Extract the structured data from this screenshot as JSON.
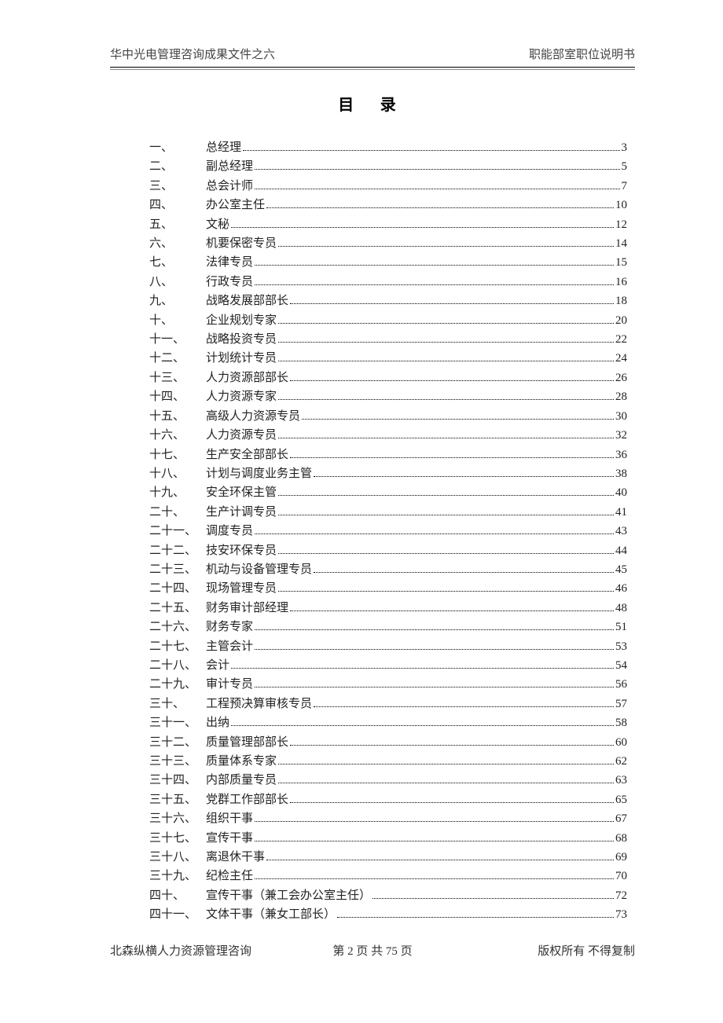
{
  "header": {
    "left": "华中光电管理咨询成果文件之六",
    "right": "职能部室职位说明书"
  },
  "title": "目 录",
  "toc": [
    {
      "num": "一、",
      "title": "总经理",
      "page": "3"
    },
    {
      "num": "二、",
      "title": "副总经理",
      "page": "5"
    },
    {
      "num": "三、",
      "title": "总会计师",
      "page": "7"
    },
    {
      "num": "四、",
      "title": "办公室主任",
      "page": "10"
    },
    {
      "num": "五、",
      "title": "文秘",
      "page": "12"
    },
    {
      "num": "六、",
      "title": "机要保密专员",
      "page": "14"
    },
    {
      "num": "七、",
      "title": "法律专员",
      "page": "15"
    },
    {
      "num": "八、",
      "title": "行政专员",
      "page": "16"
    },
    {
      "num": "九、",
      "title": "战略发展部部长",
      "page": "18"
    },
    {
      "num": "十、",
      "title": "企业规划专家",
      "page": "20"
    },
    {
      "num": "十一、",
      "title": "战略投资专员",
      "page": "22"
    },
    {
      "num": "十二、",
      "title": "计划统计专员",
      "page": "24"
    },
    {
      "num": "十三、",
      "title": "人力资源部部长",
      "page": "26"
    },
    {
      "num": "十四、",
      "title": "人力资源专家",
      "page": "28"
    },
    {
      "num": "十五、",
      "title": "高级人力资源专员",
      "page": "30"
    },
    {
      "num": "十六、",
      "title": "人力资源专员",
      "page": "32"
    },
    {
      "num": "十七、",
      "title": "生产安全部部长",
      "page": "36"
    },
    {
      "num": "十八、",
      "title": "计划与调度业务主管",
      "page": "38"
    },
    {
      "num": "十九、",
      "title": "安全环保主管",
      "page": "40"
    },
    {
      "num": "二十、",
      "title": "生产计调专员",
      "page": "41"
    },
    {
      "num": "二十一、",
      "title": "调度专员",
      "page": "43"
    },
    {
      "num": "二十二、",
      "title": "技安环保专员",
      "page": "44"
    },
    {
      "num": "二十三、",
      "title": "机动与设备管理专员",
      "page": "45"
    },
    {
      "num": "二十四、",
      "title": "现场管理专员",
      "page": "46"
    },
    {
      "num": "二十五、",
      "title": "财务审计部经理",
      "page": "48"
    },
    {
      "num": "二十六、",
      "title": "财务专家",
      "page": "51"
    },
    {
      "num": "二十七、",
      "title": "主管会计",
      "page": "53"
    },
    {
      "num": "二十八、",
      "title": "会计",
      "page": "54"
    },
    {
      "num": "二十九、",
      "title": "审计专员",
      "page": "56"
    },
    {
      "num": "三十、",
      "title": "工程预决算审核专员",
      "page": "57"
    },
    {
      "num": "三十一、",
      "title": "出纳",
      "page": "58"
    },
    {
      "num": "三十二、",
      "title": "质量管理部部长",
      "page": "60"
    },
    {
      "num": "三十三、",
      "title": "质量体系专家",
      "page": "62"
    },
    {
      "num": "三十四、",
      "title": "内部质量专员",
      "page": "63"
    },
    {
      "num": "三十五、",
      "title": "党群工作部部长",
      "page": "65"
    },
    {
      "num": "三十六、",
      "title": "组织干事",
      "page": "67"
    },
    {
      "num": "三十七、",
      "title": "宣传干事",
      "page": "68"
    },
    {
      "num": "三十八、",
      "title": "离退休干事",
      "page": "69"
    },
    {
      "num": "三十九、",
      "title": "纪检主任",
      "page": "70"
    },
    {
      "num": "四十、",
      "title": "宣传干事（兼工会办公室主任）",
      "page": "72"
    },
    {
      "num": "四十一、",
      "title": "文体干事（兼女工部长）",
      "page": "73"
    }
  ],
  "footer": {
    "left": "北森纵横人力资源管理咨询",
    "center": "第 2 页 共 75 页",
    "right": "版权所有  不得复制"
  }
}
